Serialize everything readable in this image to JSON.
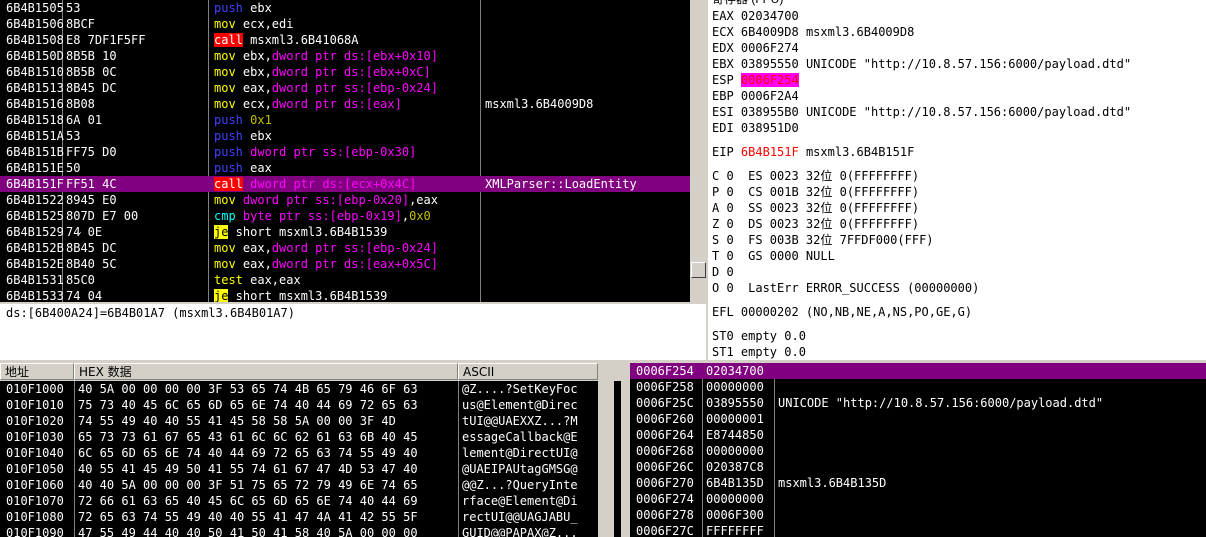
{
  "registers_title": "寄存器 (FPU)",
  "disasm": {
    "rows": [
      {
        "addr": "6B4B1505",
        "hex": "53",
        "arrow": "",
        "asm": [
          [
            "push",
            "m-push"
          ],
          [
            " ebx",
            ""
          ]
        ],
        "comment": ""
      },
      {
        "addr": "6B4B1506",
        "hex": "8BCF",
        "arrow": "",
        "asm": [
          [
            "mov",
            "m-mov"
          ],
          [
            " ecx,edi",
            ""
          ]
        ],
        "comment": ""
      },
      {
        "addr": "6B4B1508",
        "hex": "E8 7DF1F5FF",
        "arrow": "",
        "asm": [
          [
            "call",
            "m-call"
          ],
          [
            " msxml3.6B41068A",
            ""
          ]
        ],
        "comment": ""
      },
      {
        "addr": "6B4B150D",
        "hex": "8B5B 10",
        "arrow": "",
        "asm": [
          [
            "mov",
            "m-mov"
          ],
          [
            " ebx,",
            ""
          ],
          [
            "dword ptr ds:[ebx+0x10]",
            "brk"
          ]
        ],
        "comment": ""
      },
      {
        "addr": "6B4B1510",
        "hex": "8B5B 0C",
        "arrow": "",
        "asm": [
          [
            "mov",
            "m-mov"
          ],
          [
            " ebx,",
            ""
          ],
          [
            "dword ptr ds:[ebx+0xC]",
            "brk"
          ]
        ],
        "comment": ""
      },
      {
        "addr": "6B4B1513",
        "hex": "8B45 DC",
        "arrow": "",
        "asm": [
          [
            "mov",
            "m-mov"
          ],
          [
            " eax,",
            ""
          ],
          [
            "dword ptr ss:[ebp-0x24]",
            "brk"
          ]
        ],
        "comment": ""
      },
      {
        "addr": "6B4B1516",
        "hex": "8B08",
        "arrow": "",
        "asm": [
          [
            "mov",
            "m-mov"
          ],
          [
            " ecx,",
            ""
          ],
          [
            "dword ptr ds:[eax]",
            "brk"
          ]
        ],
        "comment": "msxml3.6B4009D8"
      },
      {
        "addr": "6B4B1518",
        "hex": "6A 01",
        "arrow": "",
        "asm": [
          [
            "push",
            "m-push"
          ],
          [
            " 0x1",
            "num2"
          ]
        ],
        "comment": ""
      },
      {
        "addr": "6B4B151A",
        "hex": "53",
        "arrow": "",
        "asm": [
          [
            "push",
            "m-push"
          ],
          [
            " ebx",
            ""
          ]
        ],
        "comment": ""
      },
      {
        "addr": "6B4B151B",
        "hex": "FF75 D0",
        "arrow": "",
        "asm": [
          [
            "push",
            "m-push"
          ],
          [
            " dword ptr ss:[ebp-0x30]",
            "brk"
          ]
        ],
        "comment": ""
      },
      {
        "addr": "6B4B151E",
        "hex": "50",
        "arrow": "",
        "asm": [
          [
            "push",
            "m-push"
          ],
          [
            " eax",
            ""
          ]
        ],
        "comment": ""
      },
      {
        "addr": "6B4B151F",
        "hex": "FF51 4C",
        "arrow": "",
        "asm": [
          [
            "call",
            "m-call"
          ],
          [
            " dword ptr ds:[ecx+0x4C]",
            "brk"
          ]
        ],
        "comment": "XMLParser::LoadEntity"
      },
      {
        "addr": "6B4B1522",
        "hex": "8945 E0",
        "arrow": "",
        "asm": [
          [
            "mov",
            "m-mov"
          ],
          [
            " dword ptr ss:[ebp-0x20]",
            "brk"
          ],
          [
            ",eax",
            ""
          ]
        ],
        "comment": ""
      },
      {
        "addr": "6B4B1525",
        "hex": "807D E7 00",
        "arrow": "",
        "asm": [
          [
            "cmp",
            "m-cmp"
          ],
          [
            " byte ptr ss:[ebp-0x19]",
            "brk"
          ],
          [
            ",",
            ""
          ],
          [
            "0x0",
            "num2"
          ]
        ],
        "comment": ""
      },
      {
        "addr": "6B4B1529",
        "hex": "74 0E",
        "arrow": "⌄",
        "asm": [
          [
            "je",
            "m-jcc"
          ],
          [
            " short msxml3.6B4B1539",
            ""
          ]
        ],
        "comment": ""
      },
      {
        "addr": "6B4B152B",
        "hex": "8B45 DC",
        "arrow": "",
        "asm": [
          [
            "mov",
            "m-mov"
          ],
          [
            " eax,",
            ""
          ],
          [
            "dword ptr ss:[ebp-0x24]",
            "brk"
          ]
        ],
        "comment": ""
      },
      {
        "addr": "6B4B152E",
        "hex": "8B40 5C",
        "arrow": "",
        "asm": [
          [
            "mov",
            "m-mov"
          ],
          [
            " eax,",
            ""
          ],
          [
            "dword ptr ds:[eax+0x5C]",
            "brk"
          ]
        ],
        "comment": ""
      },
      {
        "addr": "6B4B1531",
        "hex": "85C0",
        "arrow": "",
        "asm": [
          [
            "test",
            "m-test"
          ],
          [
            " eax,eax",
            ""
          ]
        ],
        "comment": ""
      },
      {
        "addr": "6B4B1533",
        "hex": "74 04",
        "arrow": "",
        "asm": [
          [
            "je",
            "m-jcc"
          ],
          [
            " short msxml3.6B4B1539",
            ""
          ]
        ],
        "comment": ""
      }
    ],
    "selected_index": 11
  },
  "info_text": "ds:[6B400A24]=6B4B01A7 (msxml3.6B4B01A7)",
  "regs": {
    "general": [
      {
        "name": "EAX",
        "value": "02034700",
        "comment": ""
      },
      {
        "name": "ECX",
        "value": "6B4009D8",
        "comment": "msxml3.6B4009D8"
      },
      {
        "name": "EDX",
        "value": "0006F274",
        "comment": ""
      },
      {
        "name": "EBX",
        "value": "03895550",
        "comment": "UNICODE \"http://10.8.57.156:6000/payload.dtd\""
      },
      {
        "name": "ESP",
        "value": "0006F254",
        "comment": "",
        "highlight": true
      },
      {
        "name": "EBP",
        "value": "0006F2A4",
        "comment": ""
      },
      {
        "name": "ESI",
        "value": "038955B0",
        "comment": "UNICODE \"http://10.8.57.156:6000/payload.dtd\""
      },
      {
        "name": "EDI",
        "value": "038951D0",
        "comment": ""
      }
    ],
    "eip": {
      "name": "EIP",
      "value": "6B4B151F",
      "comment": "msxml3.6B4B151F"
    },
    "flags": [
      "C 0  ES 0023 32位 0(FFFFFFFF)",
      "P 0  CS 001B 32位 0(FFFFFFFF)",
      "A 0  SS 0023 32位 0(FFFFFFFF)",
      "Z 0  DS 0023 32位 0(FFFFFFFF)",
      "S 0  FS 003B 32位 7FFDF000(FFF)",
      "T 0  GS 0000 NULL",
      "D 0",
      "O 0  LastErr ERROR_SUCCESS (00000000)"
    ],
    "efl": "EFL 00000202 (NO,NB,NE,A,NS,PO,GE,G)",
    "fpu": [
      "ST0 empty 0.0",
      "ST1 empty 0.0"
    ]
  },
  "hex": {
    "headers": {
      "addr": "地址",
      "hex": "HEX 数据",
      "ascii": "ASCII"
    },
    "rows": [
      {
        "addr": "010F1000",
        "bytes": "40 5A 00 00 00 00 3F 53 65 74 4B 65 79 46 6F 63",
        "ascii": "@Z....?SetKeyFoc"
      },
      {
        "addr": "010F1010",
        "bytes": "75 73 40 45 6C 65 6D 65 6E 74 40 44 69 72 65 63",
        "ascii": "us@Element@Direc"
      },
      {
        "addr": "010F1020",
        "bytes": "74 55 49 40 40 55 41 45 58 58 5A 00 00 3F 4D",
        "ascii": "tUI@@UAEXXZ...?M"
      },
      {
        "addr": "010F1030",
        "bytes": "65 73 73 61 67 65 43 61 6C 6C 62 61 63 6B 40 45",
        "ascii": "essageCallback@E"
      },
      {
        "addr": "010F1040",
        "bytes": "6C 65 6D 65 6E 74 40 44 69 72 65 63 74 55 49 40",
        "ascii": "lement@DirectUI@"
      },
      {
        "addr": "010F1050",
        "bytes": "40 55 41 45 49 50 41 55 74 61 67 47 4D 53 47 40",
        "ascii": "@UAEIPAUtagGMSG@"
      },
      {
        "addr": "010F1060",
        "bytes": "40 40 5A 00 00 00 3F 51 75 65 72 79 49 6E 74 65",
        "ascii": "@@Z...?QueryInte"
      },
      {
        "addr": "010F1070",
        "bytes": "72 66 61 63 65 40 45 6C 65 6D 65 6E 74 40 44 69",
        "ascii": "rface@Element@Di"
      },
      {
        "addr": "010F1080",
        "bytes": "72 65 63 74 55 49 40 40 55 41 47 4A 41 42 55 5F",
        "ascii": "rectUI@@UAGJABU_"
      },
      {
        "addr": "010F1090",
        "bytes": "47 55 49 44 40 40 50 41 50 41 58 40 5A 00 00 00",
        "ascii": "GUID@@PAPAX@Z..."
      }
    ]
  },
  "stack": {
    "rows": [
      {
        "addr": "0006F254",
        "value": "02034700",
        "comment": ""
      },
      {
        "addr": "0006F258",
        "value": "00000000",
        "comment": ""
      },
      {
        "addr": "0006F25C",
        "value": "03895550",
        "comment": "UNICODE \"http://10.8.57.156:6000/payload.dtd\""
      },
      {
        "addr": "0006F260",
        "value": "00000001",
        "comment": ""
      },
      {
        "addr": "0006F264",
        "value": "E8744850",
        "comment": ""
      },
      {
        "addr": "0006F268",
        "value": "00000000",
        "comment": ""
      },
      {
        "addr": "0006F26C",
        "value": "020387C8",
        "comment": ""
      },
      {
        "addr": "0006F270",
        "value": "6B4B135D",
        "comment": "msxml3.6B4B135D"
      },
      {
        "addr": "0006F274",
        "value": "00000000",
        "comment": ""
      },
      {
        "addr": "0006F278",
        "value": "0006F300",
        "comment": ""
      },
      {
        "addr": "0006F27C",
        "value": "FFFFFFFF",
        "comment": ""
      }
    ],
    "selected_index": 0
  }
}
